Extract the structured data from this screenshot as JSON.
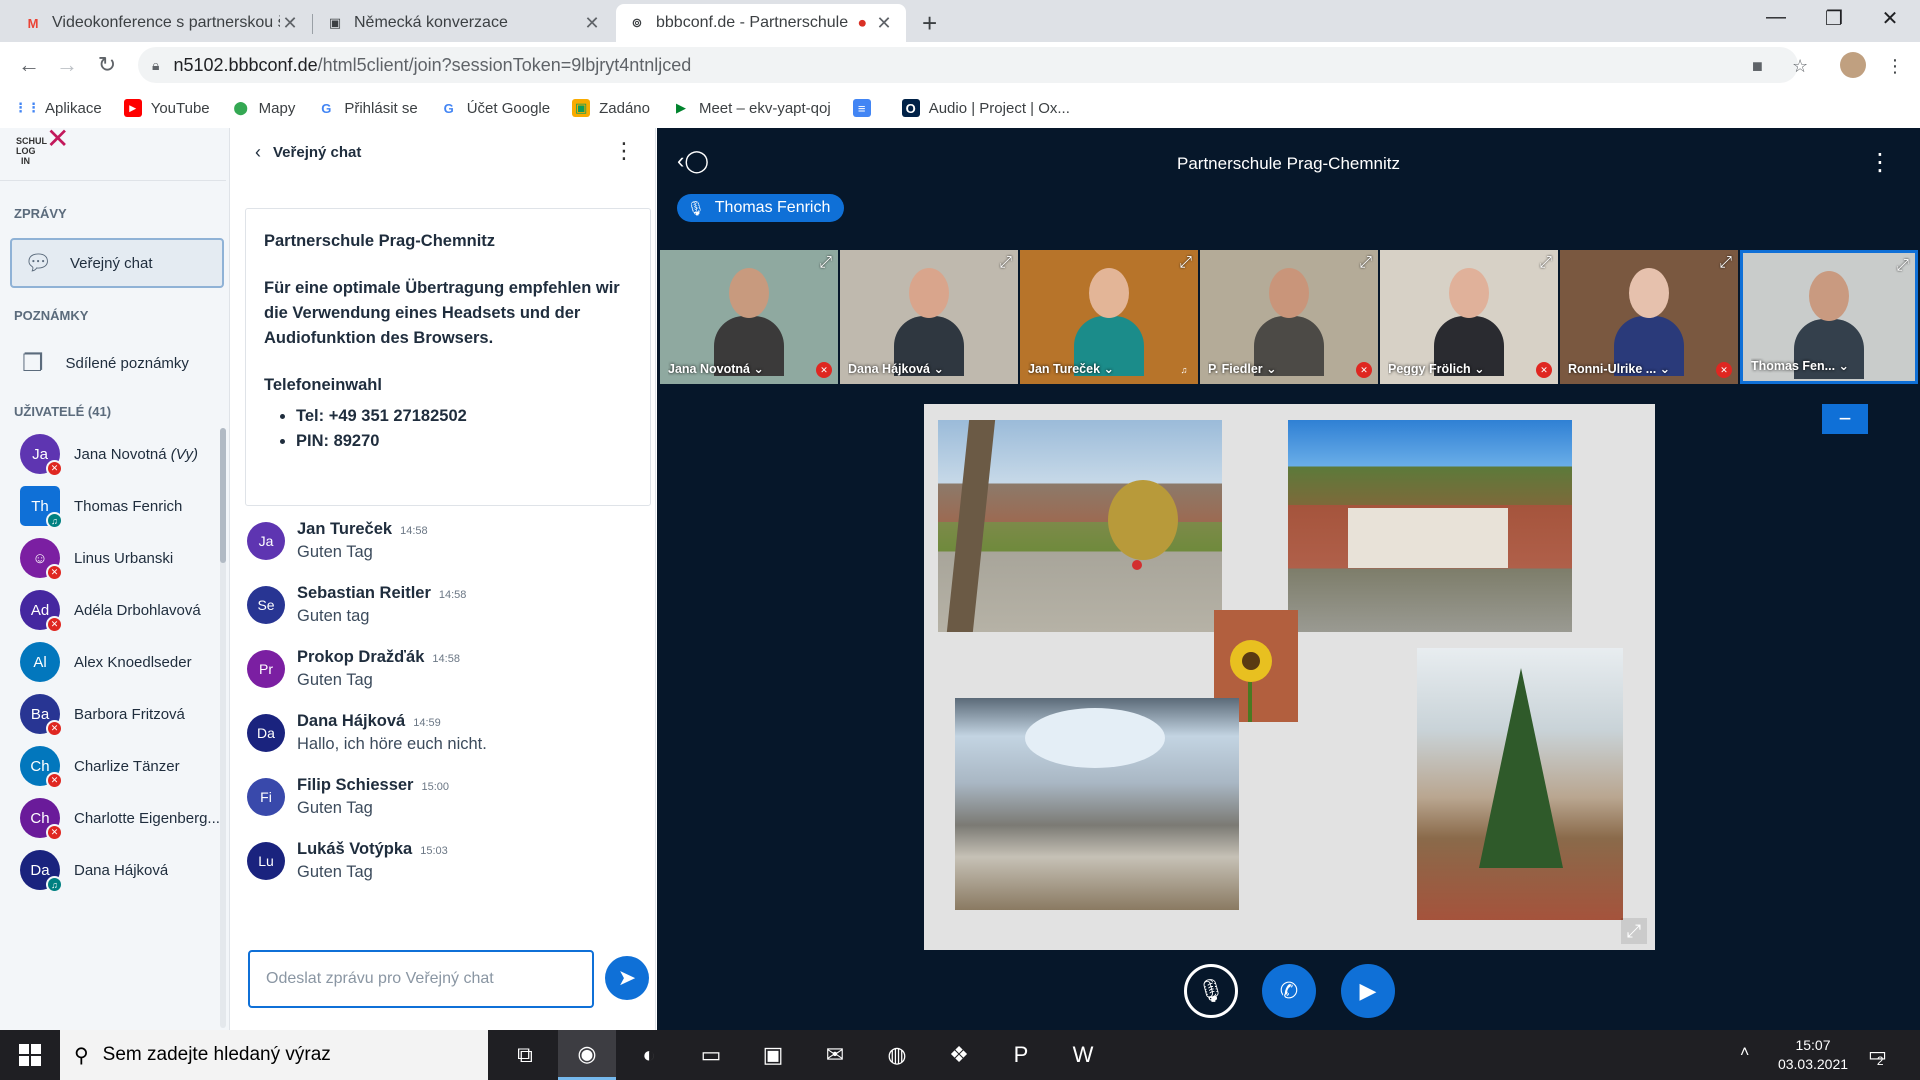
{
  "browser": {
    "tabs": [
      {
        "title": "Videokonference s partnerskou š",
        "icon": "gmail-icon"
      },
      {
        "title": "Německá konverzace",
        "icon": "classroom-icon"
      },
      {
        "title": "bbbconf.de - Partnerschule P",
        "icon": "bbb-icon",
        "recording": true
      }
    ],
    "url_host": "n5102.bbbconf.de",
    "url_path": "/html5client/join?sessionToken=9lbjryt4ntnljced",
    "bookmarks": [
      {
        "label": "Aplikace",
        "icon": "apps-grid-icon",
        "color": "#4285f4"
      },
      {
        "label": "YouTube",
        "icon": "youtube-icon",
        "color": "#ff0000"
      },
      {
        "label": "Mapy",
        "icon": "maps-pin-icon",
        "color": "#34a853"
      },
      {
        "label": "Přihlásit se",
        "icon": "google-icon",
        "color": "#4285f4"
      },
      {
        "label": "Účet Google",
        "icon": "google-icon",
        "color": "#4285f4"
      },
      {
        "label": "Zadáno",
        "icon": "classroom-icon",
        "color": "#0f9d58"
      },
      {
        "label": "Meet – ekv-yapt-qoj",
        "icon": "meet-icon",
        "color": "#00832d"
      },
      {
        "label": "",
        "icon": "docs-icon",
        "color": "#4285f4"
      },
      {
        "label": "Audio | Project | Ox...",
        "icon": "oxford-icon",
        "color": "#002147"
      }
    ]
  },
  "sidebar": {
    "logo_text": "SCHUL LOG IN",
    "messages_title": "ZPRÁVY",
    "public_chat_label": "Veřejný chat",
    "notes_title": "POZNÁMKY",
    "shared_notes_label": "Sdílené poznámky",
    "users_title": "UŽIVATELÉ (41)",
    "users": [
      {
        "initials": "Ja",
        "name": "Jana Novotná",
        "suffix": "(Vy)",
        "color": "#5e35b1",
        "status": "muted"
      },
      {
        "initials": "Th",
        "name": "Thomas Fenrich",
        "suffix": "",
        "color": "#0f70d7",
        "status": "listen",
        "presenter": true
      },
      {
        "initials": "☺",
        "name": "Linus Urbanski",
        "suffix": "",
        "color": "#7b1fa2",
        "status": "muted"
      },
      {
        "initials": "Ad",
        "name": "Adéla Drbohlavová",
        "suffix": "",
        "color": "#4527a0",
        "status": "muted"
      },
      {
        "initials": "Al",
        "name": "Alex Knoedlseder",
        "suffix": "",
        "color": "#0277bd",
        "status": ""
      },
      {
        "initials": "Ba",
        "name": "Barbora Fritzová",
        "suffix": "",
        "color": "#283593",
        "status": "muted"
      },
      {
        "initials": "Ch",
        "name": "Charlize Tänzer",
        "suffix": "",
        "color": "#0277bd",
        "status": "muted"
      },
      {
        "initials": "Ch",
        "name": "Charlotte Eigenberg...",
        "suffix": "",
        "color": "#6a1b9a",
        "status": "muted"
      },
      {
        "initials": "Da",
        "name": "Dana Hájková",
        "suffix": "",
        "color": "#1a237e",
        "status": "listen"
      }
    ]
  },
  "chat": {
    "header": "Veřejný chat",
    "welcome": {
      "title": "Partnerschule Prag-Chemnitz",
      "text": "Für eine optimale Übertragung empfehlen wir die Verwendung eines Headsets und der Audiofunktion des Browsers.",
      "phone_heading": "Telefoneinwahl",
      "tel": "Tel: +49 351 27182502",
      "pin": "PIN: 89270"
    },
    "messages": [
      {
        "initials": "Ja",
        "name": "Jan Tureček",
        "time": "14:58",
        "text": "Guten Tag",
        "color": "#5e35b1"
      },
      {
        "initials": "Se",
        "name": "Sebastian Reitler",
        "time": "14:58",
        "text": "Guten tag",
        "color": "#283593"
      },
      {
        "initials": "Pr",
        "name": "Prokop Dražďák",
        "time": "14:58",
        "text": "Guten Tag",
        "color": "#7b1fa2"
      },
      {
        "initials": "Da",
        "name": "Dana Hájková",
        "time": "14:59",
        "text": "Hallo, ich höre euch nicht.",
        "color": "#1a237e"
      },
      {
        "initials": "Fi",
        "name": "Filip Schiesser",
        "time": "15:00",
        "text": "Guten Tag",
        "color": "#3949ab"
      },
      {
        "initials": "Lu",
        "name": "Lukáš Votýpka",
        "time": "15:03",
        "text": "Guten Tag",
        "color": "#1a237e"
      }
    ],
    "input_placeholder": "Odeslat zprávu pro Veřejný chat"
  },
  "media": {
    "meeting_title": "Partnerschule Prag-Chemnitz",
    "talking": "Thomas Fenrich",
    "videos": [
      {
        "label": "Jana Novotná ⌄",
        "mic": "muted",
        "bg": "#8fa9a0",
        "skin": "#c89a7e",
        "cloth": "#3b3a3a"
      },
      {
        "label": "Dana Hájková ⌄",
        "mic": "",
        "bg": "#bfb9ae",
        "skin": "#d9a58c",
        "cloth": "#2f3740"
      },
      {
        "label": "Jan Tureček ⌄",
        "mic": "listen",
        "bg": "#b7742a",
        "skin": "#e3b597",
        "cloth": "#1b8c8a"
      },
      {
        "label": "P. Fiedler ⌄",
        "mic": "muted",
        "bg": "#b4ab98",
        "skin": "#c9957a",
        "cloth": "#4c4a46"
      },
      {
        "label": "Peggy Frölich ⌄",
        "mic": "muted",
        "bg": "#d7d1c6",
        "skin": "#e0b19a",
        "cloth": "#2a2b30"
      },
      {
        "label": "Ronni-Ulrike ... ⌄",
        "mic": "muted",
        "bg": "#7a5840",
        "skin": "#e6c1ad",
        "cloth": "#2a3a7a"
      },
      {
        "label": "Thomas Fen... ⌄",
        "mic": "",
        "bg": "#c9cccb",
        "skin": "#c99a80",
        "cloth": "#34404c",
        "active": true
      }
    ]
  },
  "taskbar": {
    "search_placeholder": "Sem zadejte hledaný výraz",
    "time": "15:07",
    "date": "03.03.2021",
    "notification_count": "2",
    "apps": [
      {
        "icon": "task-view-icon",
        "glyph": "⧉"
      },
      {
        "icon": "chrome-icon",
        "glyph": "◉",
        "active": true
      },
      {
        "icon": "edge-icon",
        "glyph": "◐"
      },
      {
        "icon": "file-explorer-icon",
        "glyph": "▭"
      },
      {
        "icon": "store-icon",
        "glyph": "▣"
      },
      {
        "icon": "mail-icon",
        "glyph": "✉"
      },
      {
        "icon": "firefox-icon",
        "glyph": "◍"
      },
      {
        "icon": "dropbox-icon",
        "glyph": "❖"
      },
      {
        "icon": "powerpoint-icon",
        "glyph": "P"
      },
      {
        "icon": "word-icon",
        "glyph": "W"
      }
    ]
  },
  "colors": {
    "accent": "#0f70d7",
    "media_bg": "#06172a",
    "muted": "#df2721",
    "listen": "#008081"
  }
}
